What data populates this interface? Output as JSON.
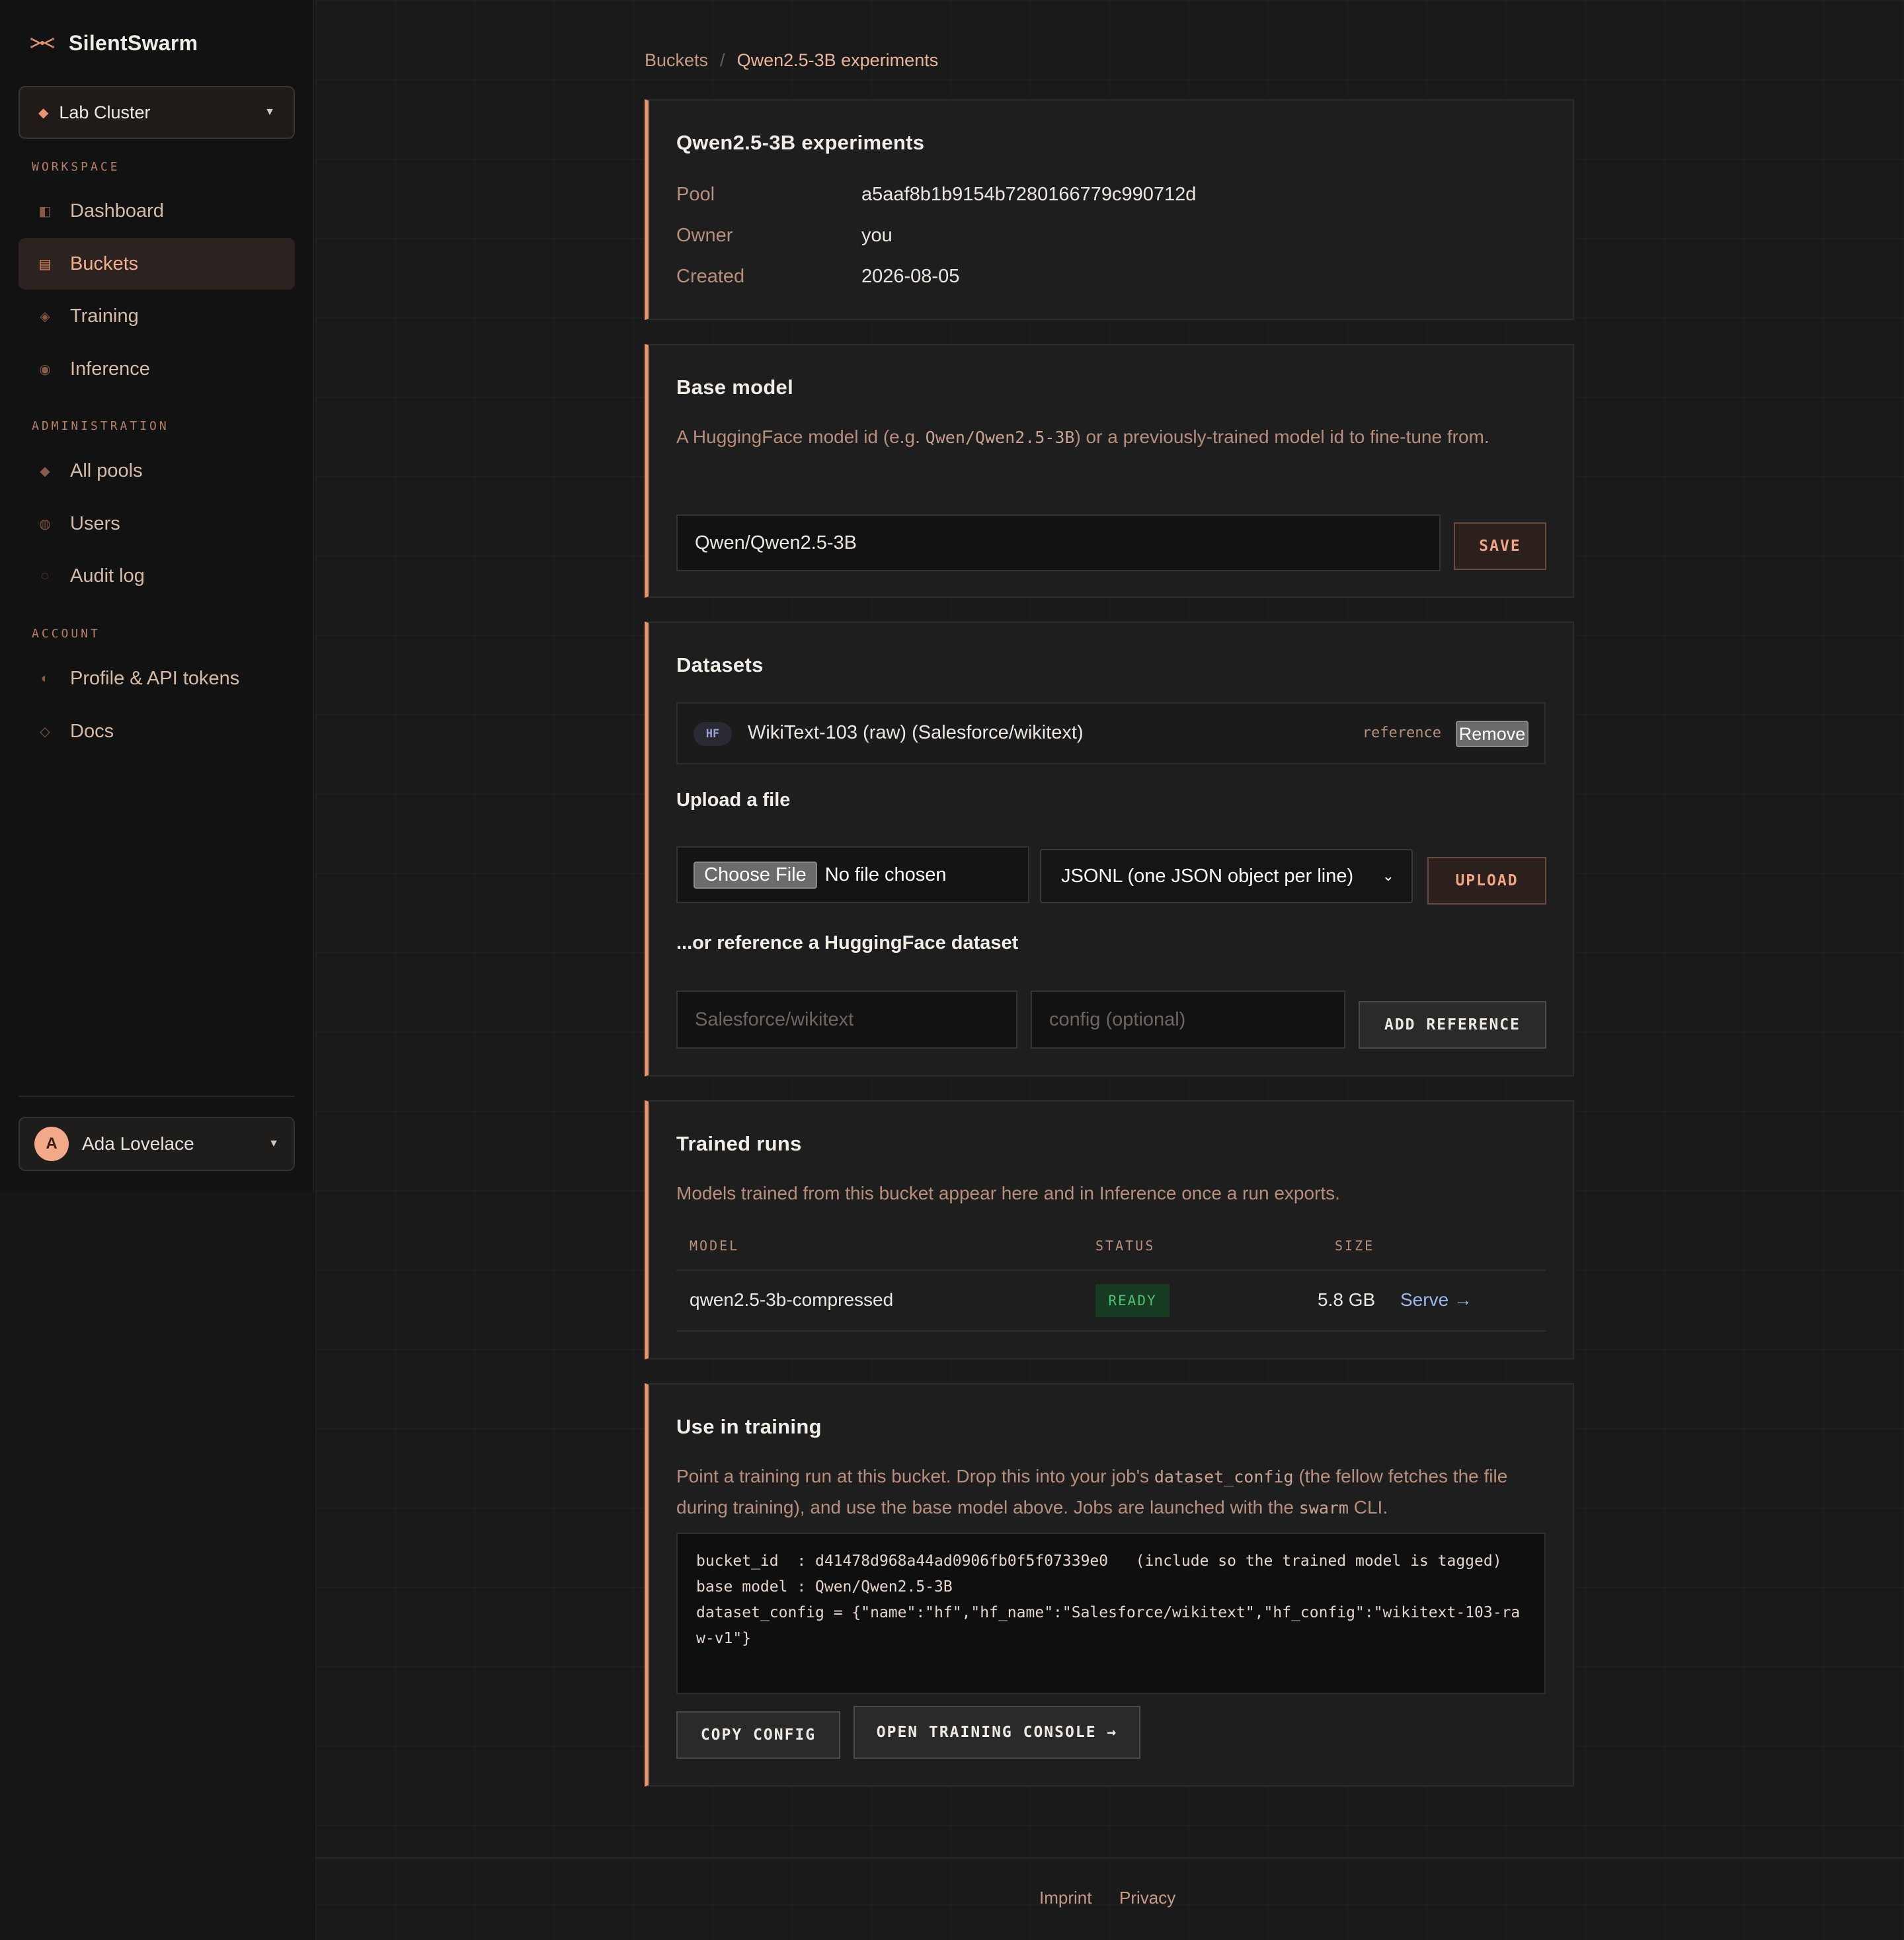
{
  "app": {
    "name": "SilentSwarm",
    "logo_icon": "swarm-icon"
  },
  "cluster_selector": {
    "label": "Lab Cluster"
  },
  "sidebar": {
    "workspace_heading": "WORKSPACE",
    "workspace": [
      {
        "label": "Dashboard",
        "icon": "dashboard-icon"
      },
      {
        "label": "Buckets",
        "icon": "buckets-icon",
        "active": true
      },
      {
        "label": "Training",
        "icon": "training-icon"
      },
      {
        "label": "Inference",
        "icon": "inference-icon"
      }
    ],
    "admin_heading": "ADMINISTRATION",
    "admin": [
      {
        "label": "All pools",
        "icon": "pools-icon"
      },
      {
        "label": "Users",
        "icon": "users-icon"
      },
      {
        "label": "Audit log",
        "icon": "audit-icon"
      }
    ],
    "account_heading": "ACCOUNT",
    "account": [
      {
        "label": "Profile & API tokens",
        "icon": "profile-icon"
      },
      {
        "label": "Docs",
        "icon": "docs-icon"
      }
    ],
    "user": {
      "initial": "A",
      "name": "Ada Lovelace"
    }
  },
  "breadcrumb": {
    "parent": "Buckets",
    "separator": "/",
    "current": "Qwen2.5-3B experiments"
  },
  "bucket": {
    "title": "Qwen2.5-3B experiments",
    "pool_label": "Pool",
    "pool_value": "a5aaf8b1b9154b7280166779c990712d",
    "owner_label": "Owner",
    "owner_value": "you",
    "created_label": "Created",
    "created_value": "2026-08-05"
  },
  "base_model": {
    "title": "Base model",
    "desc_before": "A HuggingFace model id (e.g. ",
    "desc_code": "Qwen/Qwen2.5-3B",
    "desc_after": ") or a previously-trained model id to fine-tune from.",
    "input_value": "Qwen/Qwen2.5-3B",
    "save_label": "SAVE"
  },
  "datasets": {
    "title": "Datasets",
    "items": [
      {
        "badge": "HF",
        "name": "WikiText-103 (raw) (Salesforce/wikitext)",
        "kind": "reference",
        "remove_label": "Remove"
      }
    ],
    "upload_title": "Upload a file",
    "choose_file_label": "Choose File",
    "file_status": "No file chosen",
    "format_selected": "JSONL (one JSON object per line)",
    "upload_label": "UPLOAD",
    "reference_title": "...or reference a HuggingFace dataset",
    "hf_name_placeholder": "Salesforce/wikitext",
    "hf_config_placeholder": "config (optional)",
    "add_reference_label": "ADD REFERENCE"
  },
  "trained_runs": {
    "title": "Trained runs",
    "desc": "Models trained from this bucket appear here and in Inference once a run exports.",
    "columns": {
      "model": "MODEL",
      "status": "STATUS",
      "size": "SIZE"
    },
    "rows": [
      {
        "model": "qwen2.5-3b-compressed",
        "status": "READY",
        "size": "5.8 GB",
        "action": "Serve →"
      }
    ]
  },
  "use_in_training": {
    "title": "Use in training",
    "desc_part1": "Point a training run at this bucket. Drop this into your job's ",
    "desc_code1": "dataset_config",
    "desc_part2": " (the fellow fetches the file during training), and use the base model above. Jobs are launched with the ",
    "desc_code2": "swarm",
    "desc_part3": " CLI.",
    "code": "bucket_id  : d41478d968a44ad0906fb0f5f07339e0   (include so the trained model is tagged)\nbase model : Qwen/Qwen2.5-3B\ndataset_config = {\"name\":\"hf\",\"hf_name\":\"Salesforce/wikitext\",\"hf_config\":\"wikitext-103-raw-v1\"}",
    "copy_label": "COPY CONFIG",
    "console_label": "OPEN TRAINING CONSOLE →"
  },
  "footer": {
    "imprint": "Imprint",
    "privacy": "Privacy"
  },
  "colors": {
    "accent": "#e8946f",
    "background": "#1a1a1a",
    "sidebar": "#121212",
    "ready": "#4dbf72",
    "link": "#9ab8f0"
  }
}
